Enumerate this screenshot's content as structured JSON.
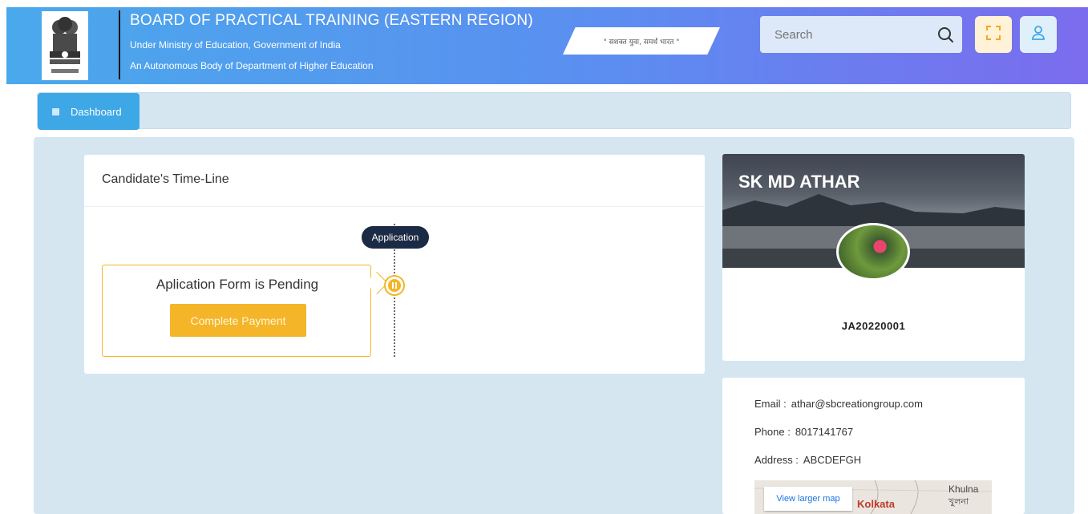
{
  "header": {
    "title": "BOARD OF PRACTICAL TRAINING (EASTERN REGION)",
    "subtitle1": "Under Ministry of Education, Government of India",
    "subtitle2": "An Autonomous Body of Department of Higher Education",
    "slogan": "\" सशक्त युवा, समर्थ भारत \"",
    "search_placeholder": "Search"
  },
  "breadcrumb": {
    "dashboard_label": "Dashboard"
  },
  "timeline": {
    "title": "Candidate's Time-Line",
    "stage_label": "Application",
    "status_text": "Aplication Form is Pending",
    "action_label": "Complete Payment"
  },
  "profile": {
    "name": "SK MD ATHAR",
    "id": "JA20220001"
  },
  "contact": {
    "email_label": "Email :",
    "email": "athar@sbcreationgroup.com",
    "phone_label": "Phone :",
    "phone": "8017141767",
    "address_label": "Address :",
    "address": "ABCDEFGH",
    "map_button": "View larger map",
    "map_city1": "Kolkata",
    "map_city2": "Khulna",
    "map_city3": "খুলনা"
  },
  "colors": {
    "header_start": "#4aa9ec",
    "header_end": "#7b6cee",
    "accent_blue": "#3ea7e6",
    "pending_yellow": "#f5b528",
    "timeline_pill": "#1c2b45"
  }
}
